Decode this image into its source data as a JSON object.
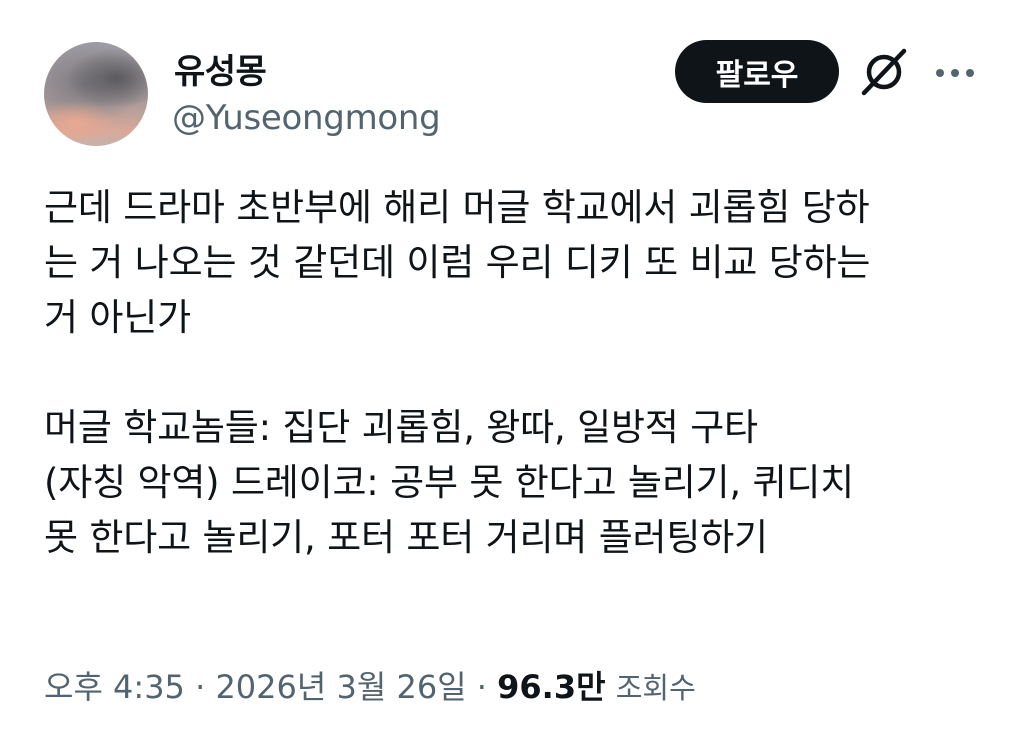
{
  "author": {
    "display_name": "유성몽",
    "handle": "@Yuseongmong"
  },
  "actions": {
    "follow_label": "팔로우",
    "grok_icon": "grok-slash-icon",
    "more_icon": "more-dots-icon"
  },
  "tweet": {
    "text": "근데 드라마 초반부에 해리 머글 학교에서 괴롭힘 당하\n는 거 나오는 것 같던데 이럼 우리 디키 또 비교 당하는\n거 아닌가\n\n머글 학교놈들: 집단 괴롭힘, 왕따, 일방적 구타\n(자칭 악역) 드레이코: 공부 못 한다고 놀리기, 퀴디치\n못 한다고 놀리기, 포터 포터 거리며 플러팅하기"
  },
  "meta": {
    "time": "오후 4:35",
    "separator": " · ",
    "date": "2026년 3월 26일",
    "views_count": "96.3만",
    "views_label": "조회수"
  },
  "colors": {
    "text": "#0f1419",
    "secondary": "#536471",
    "button_bg": "#0f1419",
    "button_text": "#ffffff"
  }
}
